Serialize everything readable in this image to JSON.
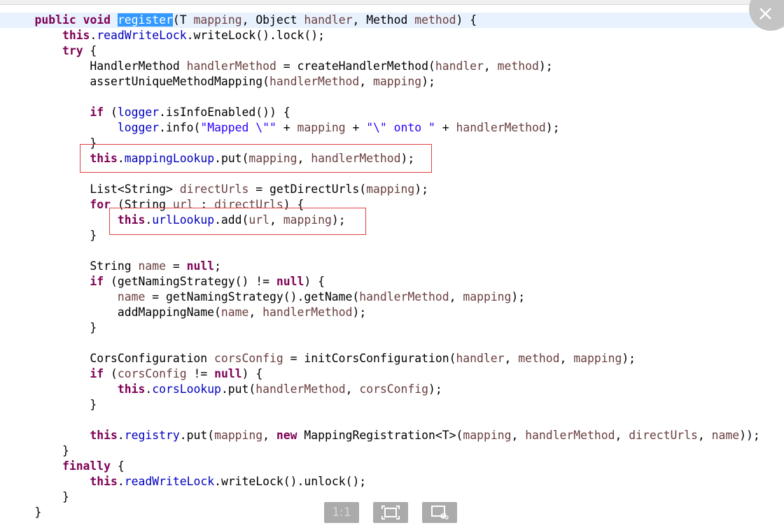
{
  "code_lines": [
    {
      "tokens": [
        {
          "t": "    "
        },
        {
          "t": "public",
          "c": "kw"
        },
        {
          "t": " "
        },
        {
          "t": "void",
          "c": "kw"
        },
        {
          "t": " "
        },
        {
          "t": "register",
          "c": "sel"
        },
        {
          "t": "(T "
        },
        {
          "t": "mapping",
          "c": "var"
        },
        {
          "t": ", Object "
        },
        {
          "t": "handler",
          "c": "var"
        },
        {
          "t": ", Method "
        },
        {
          "t": "method",
          "c": "var"
        },
        {
          "t": ") {"
        }
      ]
    },
    {
      "tokens": [
        {
          "t": "        "
        },
        {
          "t": "this",
          "c": "kw"
        },
        {
          "t": "."
        },
        {
          "t": "readWriteLock",
          "c": "field"
        },
        {
          "t": ".writeLock().lock();"
        }
      ]
    },
    {
      "tokens": [
        {
          "t": "        "
        },
        {
          "t": "try",
          "c": "kw"
        },
        {
          "t": " {"
        }
      ]
    },
    {
      "tokens": [
        {
          "t": "            HandlerMethod "
        },
        {
          "t": "handlerMethod",
          "c": "var"
        },
        {
          "t": " = createHandlerMethod("
        },
        {
          "t": "handler",
          "c": "var"
        },
        {
          "t": ", "
        },
        {
          "t": "method",
          "c": "var"
        },
        {
          "t": ");"
        }
      ]
    },
    {
      "tokens": [
        {
          "t": "            assertUniqueMethodMapping("
        },
        {
          "t": "handlerMethod",
          "c": "var"
        },
        {
          "t": ", "
        },
        {
          "t": "mapping",
          "c": "var"
        },
        {
          "t": ");"
        }
      ]
    },
    {
      "tokens": []
    },
    {
      "tokens": [
        {
          "t": "            "
        },
        {
          "t": "if",
          "c": "kw"
        },
        {
          "t": " ("
        },
        {
          "t": "logger",
          "c": "field"
        },
        {
          "t": ".isInfoEnabled()) {"
        }
      ]
    },
    {
      "tokens": [
        {
          "t": "                "
        },
        {
          "t": "logger",
          "c": "field"
        },
        {
          "t": ".info("
        },
        {
          "t": "\"Mapped \\\"\"",
          "c": "str"
        },
        {
          "t": " + "
        },
        {
          "t": "mapping",
          "c": "var"
        },
        {
          "t": " + "
        },
        {
          "t": "\"\\\" onto \"",
          "c": "str"
        },
        {
          "t": " + "
        },
        {
          "t": "handlerMethod",
          "c": "var"
        },
        {
          "t": ");"
        }
      ]
    },
    {
      "tokens": [
        {
          "t": "            }"
        }
      ]
    },
    {
      "tokens": [
        {
          "t": "            "
        },
        {
          "t": "this",
          "c": "kw"
        },
        {
          "t": "."
        },
        {
          "t": "mappingLookup",
          "c": "field"
        },
        {
          "t": ".put("
        },
        {
          "t": "mapping",
          "c": "var"
        },
        {
          "t": ", "
        },
        {
          "t": "handlerMethod",
          "c": "var"
        },
        {
          "t": ");"
        }
      ]
    },
    {
      "tokens": []
    },
    {
      "tokens": [
        {
          "t": "            List<String> "
        },
        {
          "t": "directUrls",
          "c": "var"
        },
        {
          "t": " = getDirectUrls("
        },
        {
          "t": "mapping",
          "c": "var"
        },
        {
          "t": ");"
        }
      ]
    },
    {
      "tokens": [
        {
          "t": "            "
        },
        {
          "t": "for",
          "c": "kw"
        },
        {
          "t": " (String "
        },
        {
          "t": "url",
          "c": "var"
        },
        {
          "t": " : "
        },
        {
          "t": "directUrls",
          "c": "var"
        },
        {
          "t": ") {"
        }
      ]
    },
    {
      "tokens": [
        {
          "t": "                "
        },
        {
          "t": "this",
          "c": "kw"
        },
        {
          "t": "."
        },
        {
          "t": "urlLookup",
          "c": "field"
        },
        {
          "t": ".add("
        },
        {
          "t": "url",
          "c": "var"
        },
        {
          "t": ", "
        },
        {
          "t": "mapping",
          "c": "var"
        },
        {
          "t": ");"
        }
      ]
    },
    {
      "tokens": [
        {
          "t": "            }"
        }
      ]
    },
    {
      "tokens": []
    },
    {
      "tokens": [
        {
          "t": "            String "
        },
        {
          "t": "name",
          "c": "var"
        },
        {
          "t": " = "
        },
        {
          "t": "null",
          "c": "kw"
        },
        {
          "t": ";"
        }
      ]
    },
    {
      "tokens": [
        {
          "t": "            "
        },
        {
          "t": "if",
          "c": "kw"
        },
        {
          "t": " (getNamingStrategy() != "
        },
        {
          "t": "null",
          "c": "kw"
        },
        {
          "t": ") {"
        }
      ]
    },
    {
      "tokens": [
        {
          "t": "                "
        },
        {
          "t": "name",
          "c": "var"
        },
        {
          "t": " = getNamingStrategy().getName("
        },
        {
          "t": "handlerMethod",
          "c": "var"
        },
        {
          "t": ", "
        },
        {
          "t": "mapping",
          "c": "var"
        },
        {
          "t": ");"
        }
      ]
    },
    {
      "tokens": [
        {
          "t": "                addMappingName("
        },
        {
          "t": "name",
          "c": "var"
        },
        {
          "t": ", "
        },
        {
          "t": "handlerMethod",
          "c": "var"
        },
        {
          "t": ");"
        }
      ]
    },
    {
      "tokens": [
        {
          "t": "            }"
        }
      ]
    },
    {
      "tokens": []
    },
    {
      "tokens": [
        {
          "t": "            CorsConfiguration "
        },
        {
          "t": "corsConfig",
          "c": "var"
        },
        {
          "t": " = initCorsConfiguration("
        },
        {
          "t": "handler",
          "c": "var"
        },
        {
          "t": ", "
        },
        {
          "t": "method",
          "c": "var"
        },
        {
          "t": ", "
        },
        {
          "t": "mapping",
          "c": "var"
        },
        {
          "t": ");"
        }
      ]
    },
    {
      "tokens": [
        {
          "t": "            "
        },
        {
          "t": "if",
          "c": "kw"
        },
        {
          "t": " ("
        },
        {
          "t": "corsConfig",
          "c": "var"
        },
        {
          "t": " != "
        },
        {
          "t": "null",
          "c": "kw"
        },
        {
          "t": ") {"
        }
      ]
    },
    {
      "tokens": [
        {
          "t": "                "
        },
        {
          "t": "this",
          "c": "kw"
        },
        {
          "t": "."
        },
        {
          "t": "corsLookup",
          "c": "field"
        },
        {
          "t": ".put("
        },
        {
          "t": "handlerMethod",
          "c": "var"
        },
        {
          "t": ", "
        },
        {
          "t": "corsConfig",
          "c": "var"
        },
        {
          "t": ");"
        }
      ]
    },
    {
      "tokens": [
        {
          "t": "            }"
        }
      ]
    },
    {
      "tokens": []
    },
    {
      "tokens": [
        {
          "t": "            "
        },
        {
          "t": "this",
          "c": "kw"
        },
        {
          "t": "."
        },
        {
          "t": "registry",
          "c": "field"
        },
        {
          "t": ".put("
        },
        {
          "t": "mapping",
          "c": "var"
        },
        {
          "t": ", "
        },
        {
          "t": "new",
          "c": "kw"
        },
        {
          "t": " MappingRegistration<T>("
        },
        {
          "t": "mapping",
          "c": "var"
        },
        {
          "t": ", "
        },
        {
          "t": "handlerMethod",
          "c": "var"
        },
        {
          "t": ", "
        },
        {
          "t": "directUrls",
          "c": "var"
        },
        {
          "t": ", "
        },
        {
          "t": "name",
          "c": "var"
        },
        {
          "t": "));"
        }
      ]
    },
    {
      "tokens": [
        {
          "t": "        }"
        }
      ]
    },
    {
      "tokens": [
        {
          "t": "        "
        },
        {
          "t": "finally",
          "c": "kw"
        },
        {
          "t": " {"
        }
      ]
    },
    {
      "tokens": [
        {
          "t": "            "
        },
        {
          "t": "this",
          "c": "kw"
        },
        {
          "t": "."
        },
        {
          "t": "readWriteLock",
          "c": "field"
        },
        {
          "t": ".writeLock().unlock();"
        }
      ]
    },
    {
      "tokens": [
        {
          "t": "        }"
        }
      ]
    },
    {
      "tokens": [
        {
          "t": "    }"
        }
      ]
    }
  ],
  "toolbar": {
    "actual_size_label": "1:1",
    "fit_window_icon": "fit-window-icon",
    "open_original_icon": "open-original-icon"
  },
  "close_icon": "close-icon",
  "colors": {
    "keyword": "#7f0055",
    "field": "#0000c0",
    "local_variable": "#6a3e3e",
    "string": "#2a00ff",
    "selection": "#3399ff",
    "annotation_box": "#e04040"
  }
}
